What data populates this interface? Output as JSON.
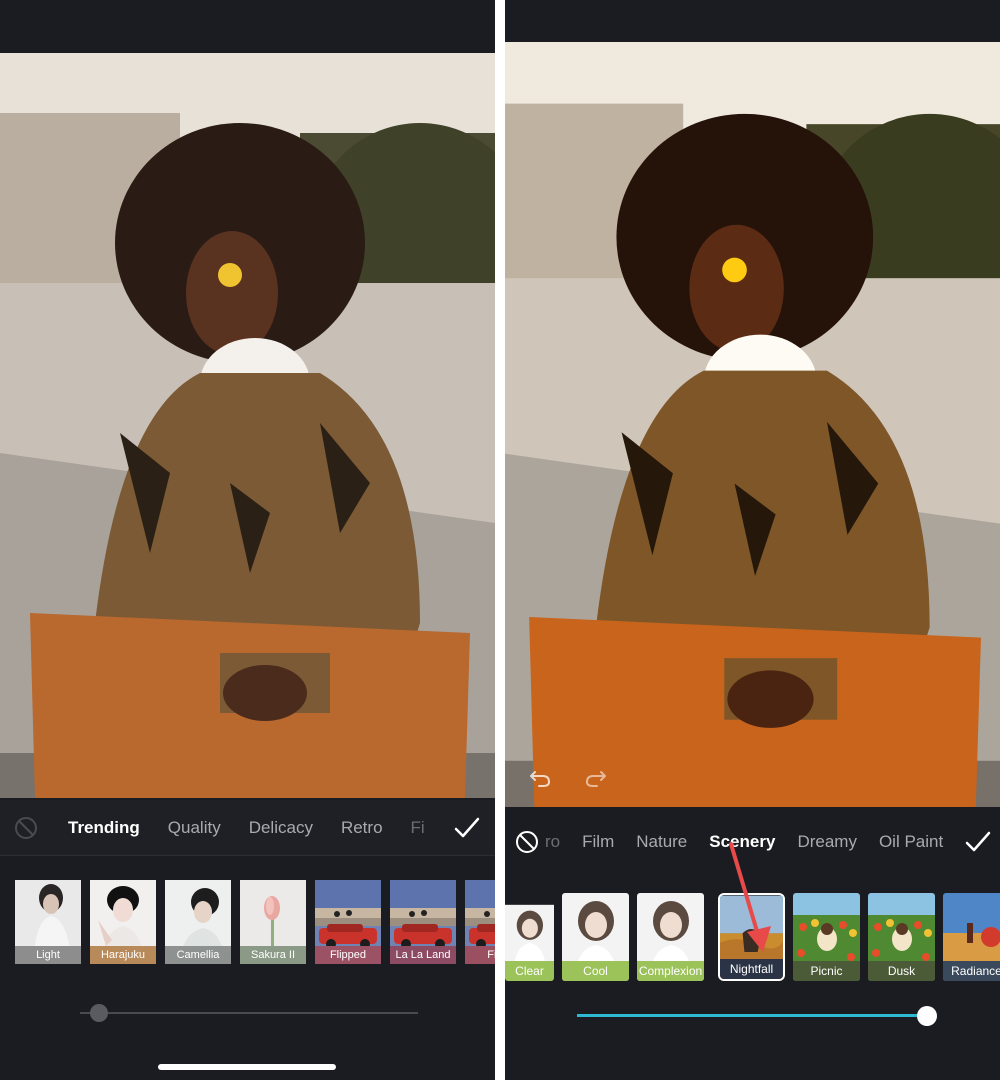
{
  "left_screen": {
    "categories": [
      "Trending",
      "Quality",
      "Delicacy",
      "Retro",
      "Fi"
    ],
    "active_category": "Trending",
    "filters": [
      {
        "label": "Light",
        "label_color": "#8d8d8d"
      },
      {
        "label": "Harajuku",
        "label_color": "#b88a5a"
      },
      {
        "label": "Camellia",
        "label_color": "#8d9190"
      },
      {
        "label": "Sakura II",
        "label_color": "#8a9a86"
      },
      {
        "label": "Flipped",
        "label_color": "#9b5265"
      },
      {
        "label": "La La Land",
        "label_color": "#8c4b62"
      },
      {
        "label": "First",
        "label_color": "#9b5062"
      }
    ],
    "slider_value": 0.03
  },
  "right_screen": {
    "categories": [
      "ro",
      "Film",
      "Nature",
      "Scenery",
      "Dreamy",
      "Oil Paint"
    ],
    "active_category": "Scenery",
    "filters": [
      {
        "label": "Clear",
        "label_color": "#9cc25a"
      },
      {
        "label": "Cool",
        "label_color": "#9cc25a"
      },
      {
        "label": "Complexion",
        "label_color": "#9cc25a"
      },
      {
        "label": "Nightfall",
        "label_color": "#2b3446"
      },
      {
        "label": "Picnic",
        "label_color": "#4b5a37"
      },
      {
        "label": "Dusk",
        "label_color": "#4b5a37"
      },
      {
        "label": "Radiance",
        "label_color": "#3a4a5c"
      }
    ],
    "selected_filter": "Nightfall",
    "slider_value": 1.0
  },
  "colors": {
    "accent": "#2db9d2",
    "background": "#1b1c21",
    "annotation_arrow": "#e84a4a"
  },
  "icons": [
    "no-filter-icon",
    "checkmark-icon",
    "undo-icon",
    "redo-icon"
  ]
}
